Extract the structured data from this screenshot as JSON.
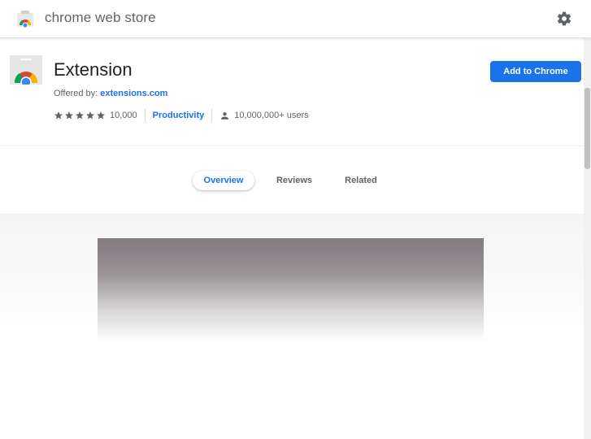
{
  "header": {
    "store_name": "chrome web store",
    "logo_icon": "chrome-web-store-logo",
    "settings_icon": "gear-icon"
  },
  "extension": {
    "title": "Extension",
    "offered_by_label": "Offered by:",
    "offered_by_link": "extensions.com",
    "rating": 5,
    "rating_count": "10,000",
    "category": "Productivity",
    "users": "10,000,000+ users",
    "add_button": "Add to Chrome"
  },
  "tabs": [
    {
      "label": "Overview",
      "active": true
    },
    {
      "label": "Reviews",
      "active": false
    },
    {
      "label": "Related",
      "active": false
    }
  ],
  "colors": {
    "accent": "#1a73e8",
    "text_secondary": "#5f6368"
  }
}
